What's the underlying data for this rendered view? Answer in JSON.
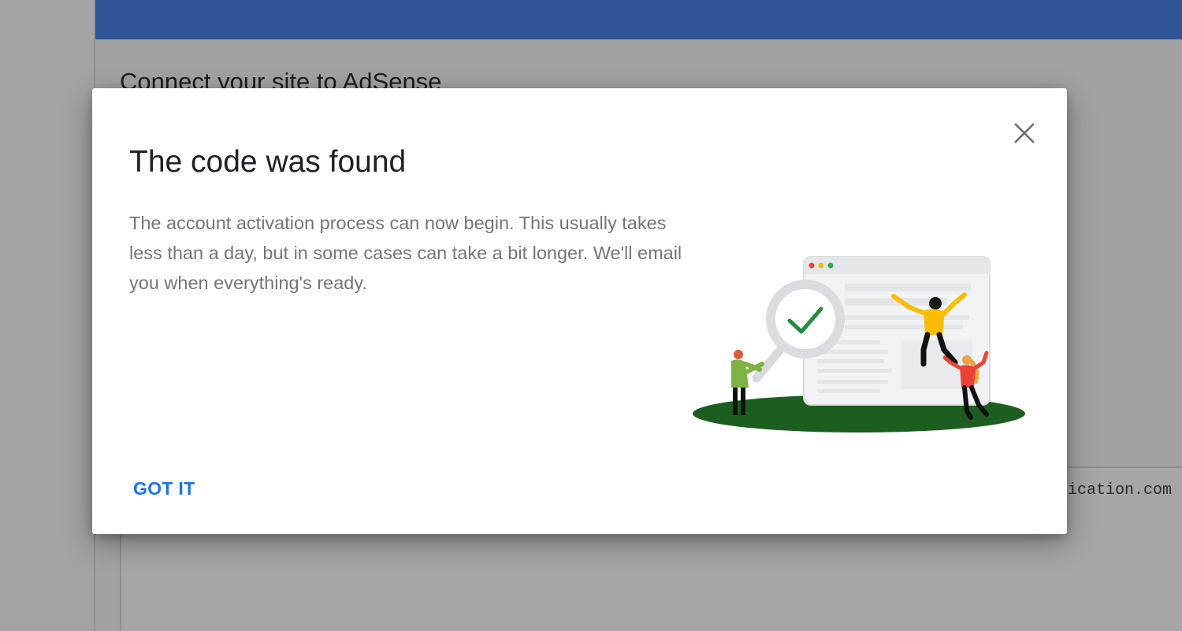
{
  "background": {
    "page_title": "Connect your site to AdSense",
    "code_snippet": "ication.com"
  },
  "dialog": {
    "title": "The code was found",
    "body": "The account activation process can now begin. This usually takes less than a day, but in some cases can take a bit longer. We'll email you when everything's ready.",
    "close_icon": "close-icon",
    "primary_button": "GOT IT",
    "illustration": "site-verified-illustration"
  },
  "colors": {
    "header_blue": "#2f5597",
    "button_blue": "#1a73e8",
    "ground_green": "#1b5e20",
    "check_green": "#1e8e3e",
    "title_text": "#202124",
    "body_text": "#757575"
  }
}
